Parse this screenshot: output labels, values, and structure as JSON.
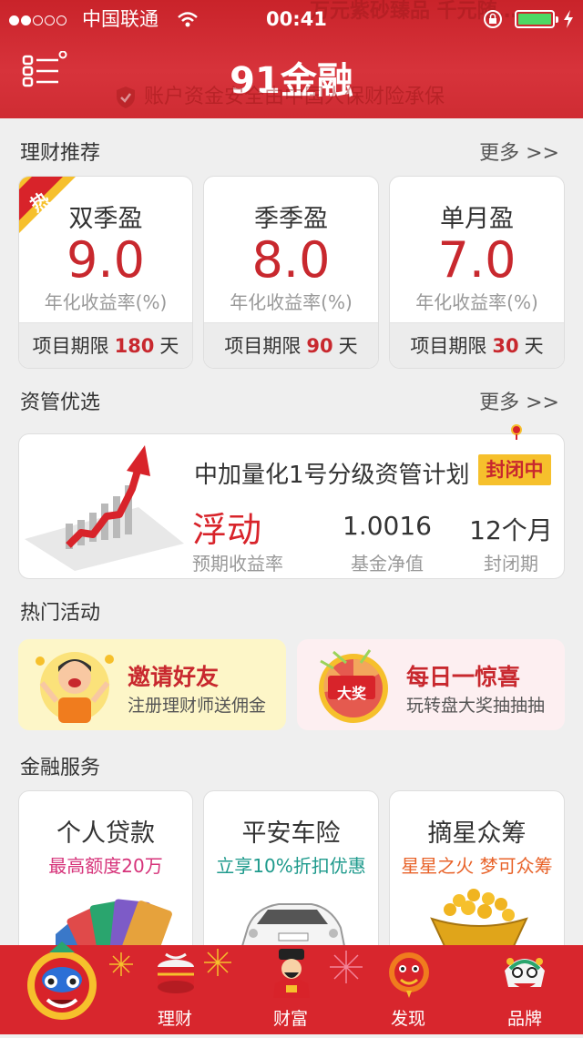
{
  "status_bar": {
    "carrier": "中国联通",
    "time": "00:41",
    "battery_level": 0.9,
    "signal_bars": 2
  },
  "header": {
    "ghost_text": "万元紫砂臻品  千元随…",
    "logo": "91金融",
    "insurance_text": "账户资金安全由中国人保财险承保"
  },
  "recommend": {
    "title": "理财推荐",
    "more": "更多 >>",
    "hot_tag": "热",
    "products": [
      {
        "name": "双季盈",
        "rate": "9.0",
        "rate_label": "年化收益率(%)",
        "term_label": "项目期限",
        "term_value": "180",
        "term_unit": "天"
      },
      {
        "name": "季季盈",
        "rate": "8.0",
        "rate_label": "年化收益率(%)",
        "term_label": "项目期限",
        "term_value": "90",
        "term_unit": "天"
      },
      {
        "name": "单月盈",
        "rate": "7.0",
        "rate_label": "年化收益率(%)",
        "term_label": "项目期限",
        "term_value": "30",
        "term_unit": "天"
      }
    ]
  },
  "asset": {
    "title": "资管优选",
    "more": "更多 >>",
    "plan_name": "中加量化1号分级资管计划",
    "status_tag": "封闭中",
    "yield": "浮动",
    "yield_label": "预期收益率",
    "nav": "1.0016",
    "nav_label": "基金净值",
    "period": "12个月",
    "period_label": "封闭期"
  },
  "activities": {
    "title": "热门活动",
    "items": [
      {
        "title": "邀请好友",
        "subtitle": "注册理财师送佣金"
      },
      {
        "title": "每日一惊喜",
        "subtitle": "玩转盘大奖抽抽抽",
        "badge": "大奖"
      }
    ]
  },
  "services": {
    "title": "金融服务",
    "items": [
      {
        "title": "个人贷款",
        "subtitle": "最高额度20万",
        "color": "#d6337a"
      },
      {
        "title": "平安车险",
        "subtitle": "立享10%折扣优惠",
        "color": "#1e9a8c"
      },
      {
        "title": "摘星众筹",
        "subtitle": "星星之火 梦可众筹",
        "color": "#e8632a"
      }
    ]
  },
  "tabbar": {
    "items": [
      {
        "label": "",
        "icon": "lion-mascot-icon"
      },
      {
        "label": "理财",
        "icon": "drum-icon"
      },
      {
        "label": "财富",
        "icon": "fortune-god-icon"
      },
      {
        "label": "发现",
        "icon": "lion-head-icon"
      },
      {
        "label": "品牌",
        "icon": "lion-dance-icon"
      }
    ]
  },
  "colors": {
    "brand_red": "#c8282e",
    "header_red": "#d7333b",
    "activity_yellow": "#fdf6c8",
    "activity_pink": "#fdeff1"
  }
}
